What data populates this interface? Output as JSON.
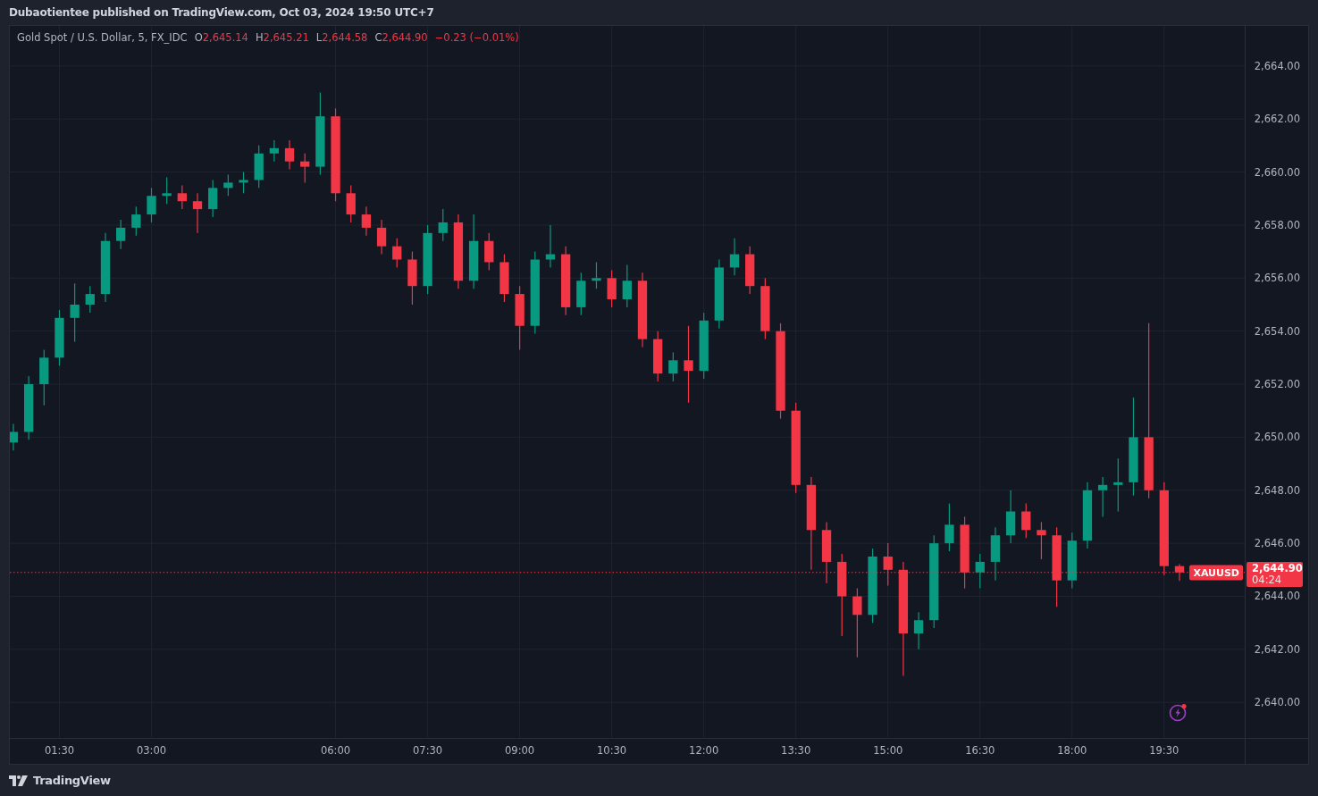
{
  "header": {
    "text": "Dubaotientee published on TradingView.com, Oct 03, 2024 19:50 UTC+7"
  },
  "legend": {
    "title": "Gold Spot / U.S. Dollar, 5, FX_IDC",
    "ohlc": [
      {
        "label": "O",
        "value": "2,645.14"
      },
      {
        "label": "H",
        "value": "2,645.21"
      },
      {
        "label": "L",
        "value": "2,644.58"
      },
      {
        "label": "C",
        "value": "2,644.90"
      }
    ],
    "change": "−0.23 (−0.01%)"
  },
  "chart": {
    "chart_data": {
      "type": "candlestick",
      "grid": true,
      "ref_lines": [
        {
          "axis": "y",
          "value": 2644.9,
          "color": "#f23645"
        }
      ],
      "xlim": [
        0.6925,
        21.83
      ],
      "ylim": [
        2638.66,
        2665.51
      ],
      "x": [
        0.75,
        1,
        1.25,
        1.5,
        1.75,
        2,
        2.25,
        2.5,
        2.75,
        3,
        3.25,
        3.5,
        3.75,
        4,
        4.25,
        4.5,
        4.75,
        5,
        5.25,
        5.5,
        5.75,
        6,
        6.25,
        6.5,
        6.75,
        7,
        7.25,
        7.5,
        7.75,
        8,
        8.25,
        8.5,
        8.75,
        9,
        9.25,
        9.5,
        9.75,
        10,
        10.25,
        10.5,
        10.75,
        11,
        11.25,
        11.5,
        11.75,
        12,
        12.25,
        12.5,
        12.75,
        13,
        13.25,
        13.5,
        13.75,
        14,
        14.25,
        14.5,
        14.75,
        15,
        15.25,
        15.5,
        15.75,
        16,
        16.25,
        16.5,
        16.75,
        17,
        17.25,
        17.5,
        17.75,
        18,
        18.25,
        18.5,
        18.75,
        19,
        19.25,
        19.5,
        19.75
      ],
      "yticks": [
        {
          "value": 2640,
          "label": "2,640.00"
        },
        {
          "value": 2642,
          "label": "2,642.00"
        },
        {
          "value": 2644,
          "label": "2,644.00"
        },
        {
          "value": 2646,
          "label": "2,646.00"
        },
        {
          "value": 2648,
          "label": "2,648.00"
        },
        {
          "value": 2650,
          "label": "2,650.00"
        },
        {
          "value": 2652,
          "label": "2,652.00"
        },
        {
          "value": 2654,
          "label": "2,654.00"
        },
        {
          "value": 2656,
          "label": "2,656.00"
        },
        {
          "value": 2658,
          "label": "2,658.00"
        },
        {
          "value": 2660,
          "label": "2,660.00"
        },
        {
          "value": 2662,
          "label": "2,662.00"
        },
        {
          "value": 2664,
          "label": "2,664.00"
        }
      ],
      "xticks": [
        {
          "value": 1.5,
          "label": "01:30"
        },
        {
          "value": 3,
          "label": "03:00"
        },
        {
          "value": 6,
          "label": "06:00"
        },
        {
          "value": 7.5,
          "label": "07:30"
        },
        {
          "value": 9,
          "label": "09:00"
        },
        {
          "value": 10.5,
          "label": "10:30"
        },
        {
          "value": 12,
          "label": "12:00"
        },
        {
          "value": 13.5,
          "label": "13:30"
        },
        {
          "value": 15,
          "label": "15:00"
        },
        {
          "value": 16.5,
          "label": "16:30"
        },
        {
          "value": 18,
          "label": "18:00"
        },
        {
          "value": 19.5,
          "label": "19:30"
        }
      ],
      "ohlc": [
        [
          2649.8,
          2650.5,
          2649.5,
          2650.2
        ],
        [
          2650.2,
          2652.3,
          2649.9,
          2652.0
        ],
        [
          2652.0,
          2653.3,
          2651.2,
          2653.0
        ],
        [
          2653.0,
          2654.8,
          2652.7,
          2654.5
        ],
        [
          2654.5,
          2655.8,
          2653.6,
          2655.0
        ],
        [
          2655.0,
          2655.7,
          2654.7,
          2655.4
        ],
        [
          2655.4,
          2657.7,
          2655.1,
          2657.4
        ],
        [
          2657.4,
          2658.2,
          2657.1,
          2657.9
        ],
        [
          2657.9,
          2658.7,
          2657.6,
          2658.4
        ],
        [
          2658.4,
          2659.4,
          2658.1,
          2659.1
        ],
        [
          2659.1,
          2659.8,
          2658.8,
          2659.2
        ],
        [
          2659.2,
          2659.5,
          2658.6,
          2658.9
        ],
        [
          2658.9,
          2659.2,
          2657.7,
          2658.6
        ],
        [
          2658.6,
          2659.7,
          2658.3,
          2659.4
        ],
        [
          2659.4,
          2659.9,
          2659.1,
          2659.6
        ],
        [
          2659.6,
          2660.0,
          2659.2,
          2659.7
        ],
        [
          2659.7,
          2661.0,
          2659.4,
          2660.7
        ],
        [
          2660.7,
          2661.2,
          2660.4,
          2660.9
        ],
        [
          2660.9,
          2661.2,
          2660.1,
          2660.4
        ],
        [
          2660.4,
          2660.7,
          2659.6,
          2660.2
        ],
        [
          2660.2,
          2663.0,
          2659.9,
          2662.1
        ],
        [
          2662.1,
          2662.4,
          2658.9,
          2659.2
        ],
        [
          2659.2,
          2659.5,
          2658.1,
          2658.4
        ],
        [
          2658.4,
          2658.7,
          2657.6,
          2657.9
        ],
        [
          2657.9,
          2658.2,
          2656.9,
          2657.2
        ],
        [
          2657.2,
          2657.5,
          2656.4,
          2656.7
        ],
        [
          2656.7,
          2657.0,
          2655.0,
          2655.7
        ],
        [
          2655.7,
          2658.0,
          2655.4,
          2657.7
        ],
        [
          2657.7,
          2658.6,
          2657.4,
          2658.1
        ],
        [
          2658.1,
          2658.4,
          2655.6,
          2655.9
        ],
        [
          2655.9,
          2658.4,
          2655.6,
          2657.4
        ],
        [
          2657.4,
          2657.7,
          2656.3,
          2656.6
        ],
        [
          2656.6,
          2656.9,
          2655.1,
          2655.4
        ],
        [
          2655.4,
          2655.7,
          2653.3,
          2654.2
        ],
        [
          2654.2,
          2657.0,
          2653.9,
          2656.7
        ],
        [
          2656.7,
          2658.0,
          2656.4,
          2656.9
        ],
        [
          2656.9,
          2657.2,
          2654.6,
          2654.9
        ],
        [
          2654.9,
          2656.2,
          2654.6,
          2655.9
        ],
        [
          2655.9,
          2656.6,
          2655.6,
          2656.0
        ],
        [
          2656.0,
          2656.3,
          2654.9,
          2655.2
        ],
        [
          2655.2,
          2656.5,
          2654.9,
          2655.9
        ],
        [
          2655.9,
          2656.2,
          2653.4,
          2653.7
        ],
        [
          2653.7,
          2654.0,
          2652.1,
          2652.4
        ],
        [
          2652.4,
          2653.2,
          2652.1,
          2652.9
        ],
        [
          2652.9,
          2654.2,
          2651.3,
          2652.5
        ],
        [
          2652.5,
          2654.7,
          2652.2,
          2654.4
        ],
        [
          2654.4,
          2656.7,
          2654.1,
          2656.4
        ],
        [
          2656.4,
          2657.5,
          2656.1,
          2656.9
        ],
        [
          2656.9,
          2657.2,
          2655.4,
          2655.7
        ],
        [
          2655.7,
          2656.0,
          2653.7,
          2654.0
        ],
        [
          2654.0,
          2654.3,
          2650.7,
          2651.0
        ],
        [
          2651.0,
          2651.3,
          2647.9,
          2648.2
        ],
        [
          2648.2,
          2648.5,
          2645.0,
          2646.5
        ],
        [
          2646.5,
          2646.8,
          2644.5,
          2645.3
        ],
        [
          2645.3,
          2645.6,
          2642.5,
          2644.0
        ],
        [
          2644.0,
          2644.3,
          2641.7,
          2643.3
        ],
        [
          2643.3,
          2645.8,
          2643.0,
          2645.5
        ],
        [
          2645.5,
          2646.0,
          2644.4,
          2645.0
        ],
        [
          2645.0,
          2645.3,
          2641.0,
          2642.6
        ],
        [
          2642.6,
          2643.4,
          2642.0,
          2643.1
        ],
        [
          2643.1,
          2646.3,
          2642.8,
          2646.0
        ],
        [
          2646.0,
          2647.5,
          2645.7,
          2646.7
        ],
        [
          2646.7,
          2647.0,
          2644.3,
          2644.9
        ],
        [
          2644.9,
          2645.6,
          2644.3,
          2645.3
        ],
        [
          2645.3,
          2646.6,
          2644.6,
          2646.3
        ],
        [
          2646.3,
          2648.0,
          2646.0,
          2647.2
        ],
        [
          2647.2,
          2647.5,
          2646.2,
          2646.5
        ],
        [
          2646.5,
          2646.8,
          2645.4,
          2646.3
        ],
        [
          2646.3,
          2646.6,
          2643.6,
          2644.6
        ],
        [
          2644.6,
          2646.4,
          2644.3,
          2646.1
        ],
        [
          2646.1,
          2648.3,
          2645.8,
          2648.0
        ],
        [
          2648.0,
          2648.5,
          2647.0,
          2648.2
        ],
        [
          2648.2,
          2649.2,
          2647.2,
          2648.3
        ],
        [
          2648.3,
          2651.5,
          2647.8,
          2650.0
        ],
        [
          2650.0,
          2654.3,
          2647.7,
          2648.0
        ],
        [
          2648.0,
          2648.3,
          2644.8,
          2645.14
        ],
        [
          2645.14,
          2645.21,
          2644.58,
          2644.9
        ]
      ]
    },
    "last_price": {
      "symbol": "XAUUSD",
      "label": "2,644.90",
      "countdown": "04:24"
    }
  },
  "footer": {
    "brand": "TradingView"
  }
}
